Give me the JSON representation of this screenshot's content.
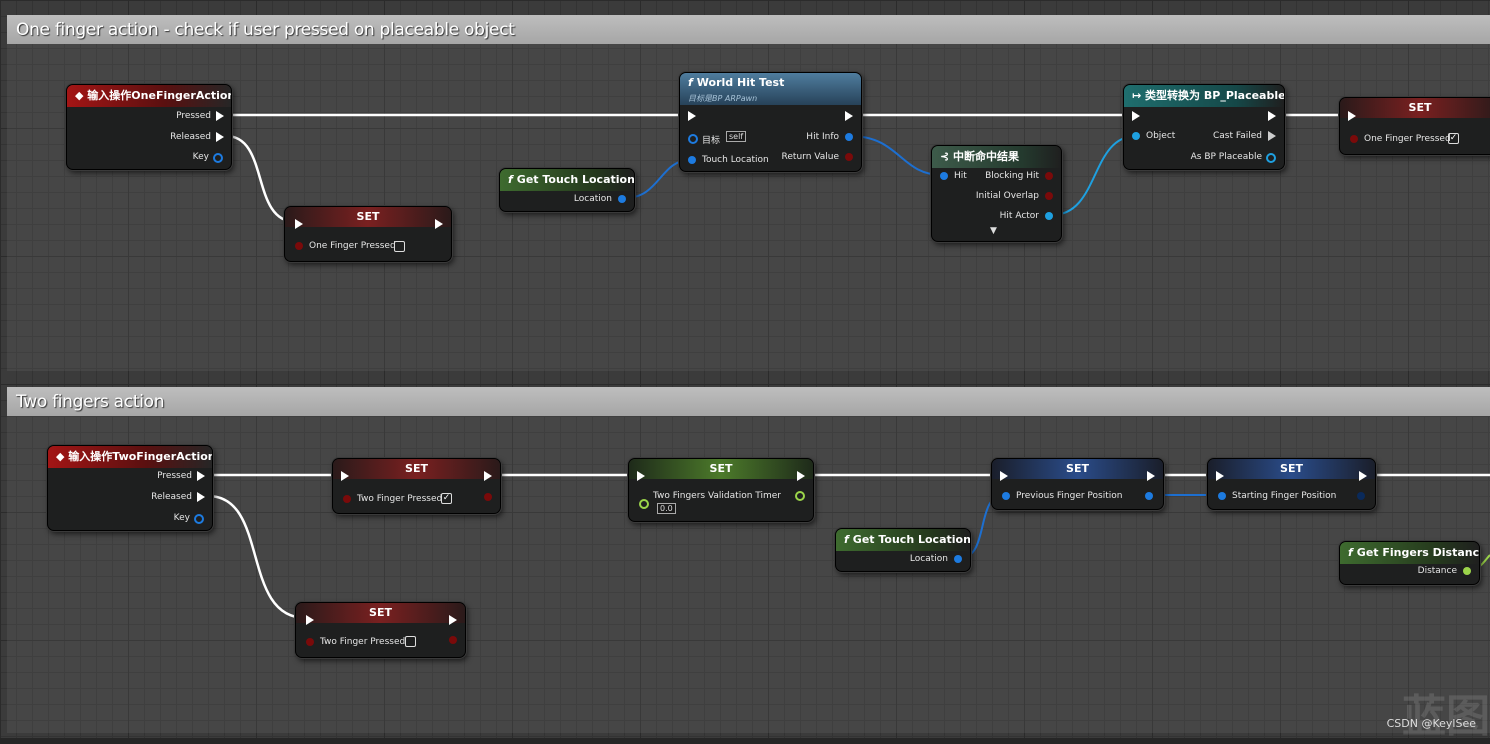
{
  "comments": {
    "one": "One finger action - check if user pressed on placeable object",
    "two": "Two fingers action"
  },
  "one": {
    "event": {
      "title": "输入操作OneFingerAction",
      "pressed": "Pressed",
      "released": "Released",
      "key": "Key"
    },
    "set_false": {
      "title": "SET",
      "var": "One Finger Pressed"
    },
    "touch": {
      "title": "Get Touch Location",
      "out": "Location"
    },
    "hit": {
      "title": "World Hit Test",
      "subtitle": "目标是BP ARPawn",
      "target": "目标",
      "self": "self",
      "touch": "Touch Location",
      "hitinfo": "Hit Info",
      "ret": "Return Value"
    },
    "break": {
      "title": "中断命中结果",
      "hit": "Hit",
      "blocking": "Blocking Hit",
      "overlap": "Initial Overlap",
      "actor": "Hit Actor"
    },
    "cast": {
      "title": "类型转换为 BP_Placeable",
      "object": "Object",
      "failed": "Cast Failed",
      "as": "As BP Placeable"
    },
    "set_true": {
      "title": "SET",
      "var": "One Finger Pressed"
    }
  },
  "two": {
    "event": {
      "title": "输入操作TwoFingerAction",
      "pressed": "Pressed",
      "released": "Released",
      "key": "Key"
    },
    "set1": {
      "title": "SET",
      "var": "Two Finger Pressed"
    },
    "set_false": {
      "title": "SET",
      "var": "Two Finger Pressed"
    },
    "timer": {
      "title": "SET",
      "var": "Two Fingers Validation Timer",
      "value": "0.0"
    },
    "touch": {
      "title": "Get Touch Location",
      "out": "Location"
    },
    "prev": {
      "title": "SET",
      "var": "Previous Finger Position"
    },
    "start": {
      "title": "SET",
      "var": "Starting Finger Position"
    },
    "dist": {
      "title": "Get Fingers Distance",
      "out": "Distance"
    }
  },
  "watermark": "CSDN @KeylSee",
  "watermark_big": "蓝图"
}
